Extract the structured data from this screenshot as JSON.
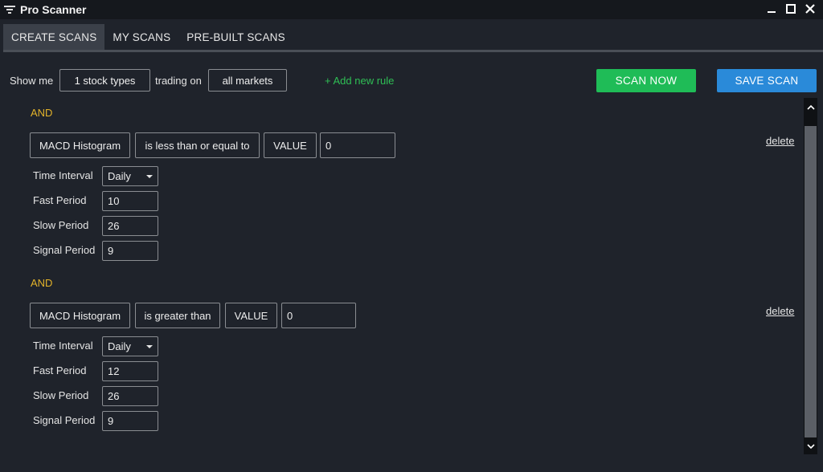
{
  "window": {
    "title": "Pro Scanner",
    "icons": {
      "app": "filter-icon",
      "minimize": "minimize-icon",
      "maximize": "maximize-icon",
      "close": "close-icon"
    }
  },
  "tabs": [
    {
      "label": "CREATE SCANS",
      "active": true
    },
    {
      "label": "MY SCANS",
      "active": false
    },
    {
      "label": "PRE-BUILT SCANS",
      "active": false
    }
  ],
  "toolbar": {
    "show_me": "Show me",
    "stock_types": "1 stock types",
    "trading_on": "trading on",
    "markets": "all markets",
    "add_rule": "+ Add new rule",
    "scan_now": "SCAN NOW",
    "save_scan": "SAVE SCAN"
  },
  "colors": {
    "background": "#1f232b",
    "and_label": "#e3b32a",
    "add_rule": "#2fbf55",
    "scan_now": "#1fbc57",
    "save_scan": "#2a8ad9"
  },
  "rules": [
    {
      "connector": "AND",
      "indicator": "MACD Histogram",
      "operator": "is less than or equal to",
      "type": "VALUE",
      "value": "0",
      "delete": "delete",
      "params": {
        "time_interval_label": "Time Interval",
        "time_interval": "Daily",
        "fast_label": "Fast Period",
        "fast": "10",
        "slow_label": "Slow Period",
        "slow": "26",
        "signal_label": "Signal Period",
        "signal": "9"
      }
    },
    {
      "connector": "AND",
      "indicator": "MACD Histogram",
      "operator": "is greater than",
      "type": "VALUE",
      "value": "0",
      "delete": "delete",
      "params": {
        "time_interval_label": "Time Interval",
        "time_interval": "Daily",
        "fast_label": "Fast Period",
        "fast": "12",
        "slow_label": "Slow Period",
        "slow": "26",
        "signal_label": "Signal Period",
        "signal": "9"
      }
    }
  ]
}
